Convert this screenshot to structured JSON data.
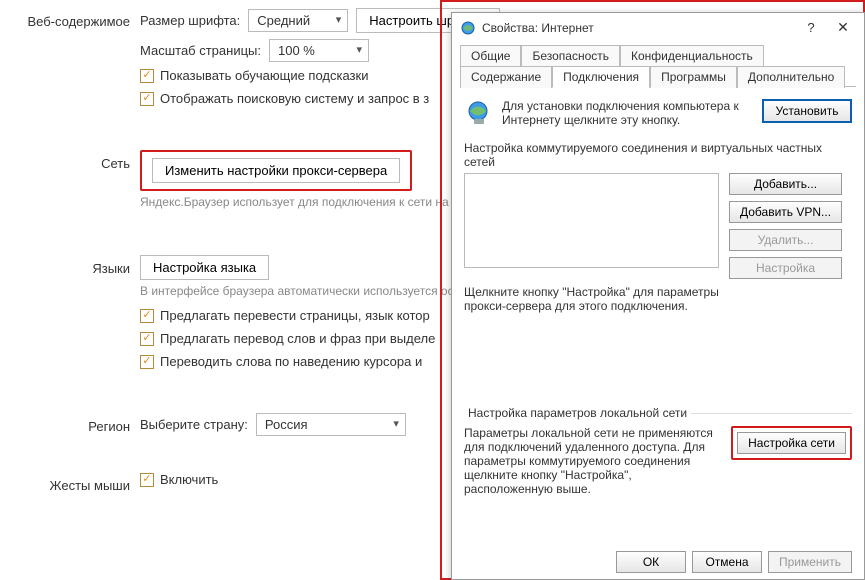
{
  "settings": {
    "web_content_section": "Веб-содержимое",
    "font_size_label": "Размер шрифта:",
    "font_size_value": "Средний",
    "font_settings_btn": "Настроить шрифты",
    "page_zoom_label": "Масштаб страницы:",
    "page_zoom_value": "100 %",
    "show_hints": "Показывать обучающие подсказки",
    "show_search": "Отображать поисковую систему и запрос в з",
    "network_section": "Сеть",
    "proxy_btn": "Изменить настройки прокси-сервера",
    "network_hint": "Яндекс.Браузер использует для подключения к сети на",
    "lang_section": "Языки",
    "lang_btn": "Настройка языка",
    "lang_hint": "В интерфейсе браузера автоматически используется ос",
    "translate_pages": "Предлагать перевести страницы, язык котор",
    "translate_words": "Предлагать перевод слов и фраз при выделе",
    "translate_hover": "Переводить слова по наведению курсора и",
    "region_section": "Регион",
    "country_label": "Выберите страну:",
    "country_value": "Россия",
    "mouse_section": "Жесты мыши",
    "mouse_enable": "Включить"
  },
  "dialog": {
    "title": "Свойства: Интернет",
    "help": "?",
    "close": "✕",
    "tabs_row1": [
      "Общие",
      "Безопасность",
      "Конфиденциальность"
    ],
    "tabs_row2": [
      "Содержание",
      "Подключения",
      "Программы",
      "Дополнительно"
    ],
    "active_tab": "Подключения",
    "install_text": "Для установки подключения компьютера к Интернету щелкните эту кнопку.",
    "install_btn": "Установить",
    "dialup_label": "Настройка коммутируемого соединения и виртуальных частных сетей",
    "add_btn": "Добавить...",
    "add_vpn_btn": "Добавить VPN...",
    "delete_btn": "Удалить...",
    "settings_btn": "Настройка",
    "proxy_hint": "Щелкните кнопку \"Настройка\" для параметры прокси-сервера для этого подключения.",
    "lan_label": "Настройка параметров локальной сети",
    "lan_text": "Параметры локальной сети не применяются для подключений удаленного доступа. Для параметры коммутируемого соединения щелкните кнопку \"Настройка\", расположенную выше.",
    "lan_btn": "Настройка сети",
    "ok_btn": "ОК",
    "cancel_btn": "Отмена",
    "apply_btn": "Применить"
  }
}
